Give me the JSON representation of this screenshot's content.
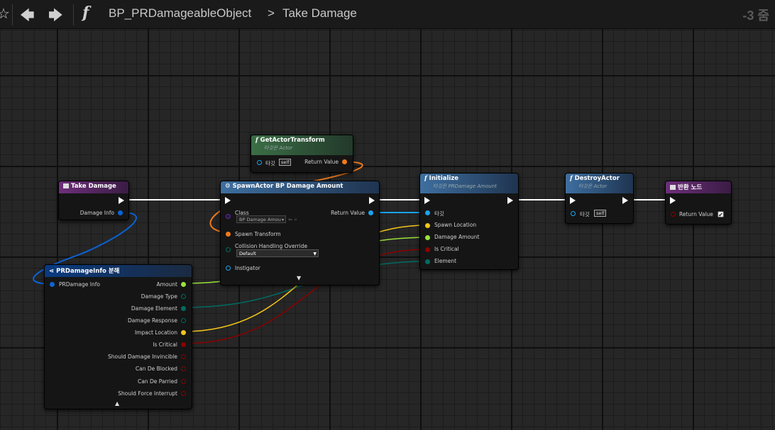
{
  "breadcrumb": {
    "blueprint": "BP_PRDamageableObject",
    "separator": ">",
    "function": "Take Damage"
  },
  "zoom_label": "-3 줌",
  "icons": {
    "favorite": "star-outline-icon",
    "back": "arrow-left-icon",
    "forward": "arrow-right-icon",
    "function": "function-f-icon"
  },
  "nodes": {
    "take_damage": {
      "title": "Take Damage",
      "pin_damage_info": "Damage Info"
    },
    "get_actor_transform": {
      "title": "GetActorTransform",
      "subtitle": "타깃은 Actor",
      "target": "타깃",
      "self": "self",
      "return_value": "Return Value"
    },
    "spawn_actor": {
      "title": "SpawnActor BP Damage Amount",
      "class": "Class",
      "class_value": "BP Damage Amou",
      "return_value": "Return Value",
      "spawn_transform": "Spawn Transform",
      "collision": "Collision Handling Override",
      "collision_value": "Default",
      "instigator": "Instigator"
    },
    "initialize": {
      "title": "Initialize",
      "subtitle": "타깃은 PRDamage Amount",
      "target": "타깃",
      "spawn_location": "Spawn Location",
      "damage_amount": "Damage Amount",
      "is_critical": "Is Critical",
      "element": "Element"
    },
    "destroy_actor": {
      "title": "DestroyActor",
      "subtitle": "타깃은 Actor",
      "target": "타깃",
      "self": "self"
    },
    "return_node": {
      "title": "반환 노드",
      "return_value": "Return Value"
    },
    "break_info": {
      "title": "PRDamageInfo 분해",
      "input": "PRDamage Info",
      "outputs": [
        "Amount",
        "Damage Type",
        "Damage Element",
        "Damage Response",
        "Impact Location",
        "Is Critical",
        "Should Damage Invincible",
        "Can De Blocked",
        "Can De Parried",
        "Should Force Interrupt"
      ]
    }
  },
  "colors": {
    "exec": "#ffffff",
    "struct": "#0a64d8",
    "object": "#1ba4f0",
    "transform": "#f07a1a",
    "vector": "#f5c518",
    "float": "#9be23a",
    "bool": "#8b0000",
    "enum": "#006b62",
    "function_header": "#3e6fa0",
    "pure_header": "#3b6e46",
    "entry_header": "#6d2f7a"
  }
}
